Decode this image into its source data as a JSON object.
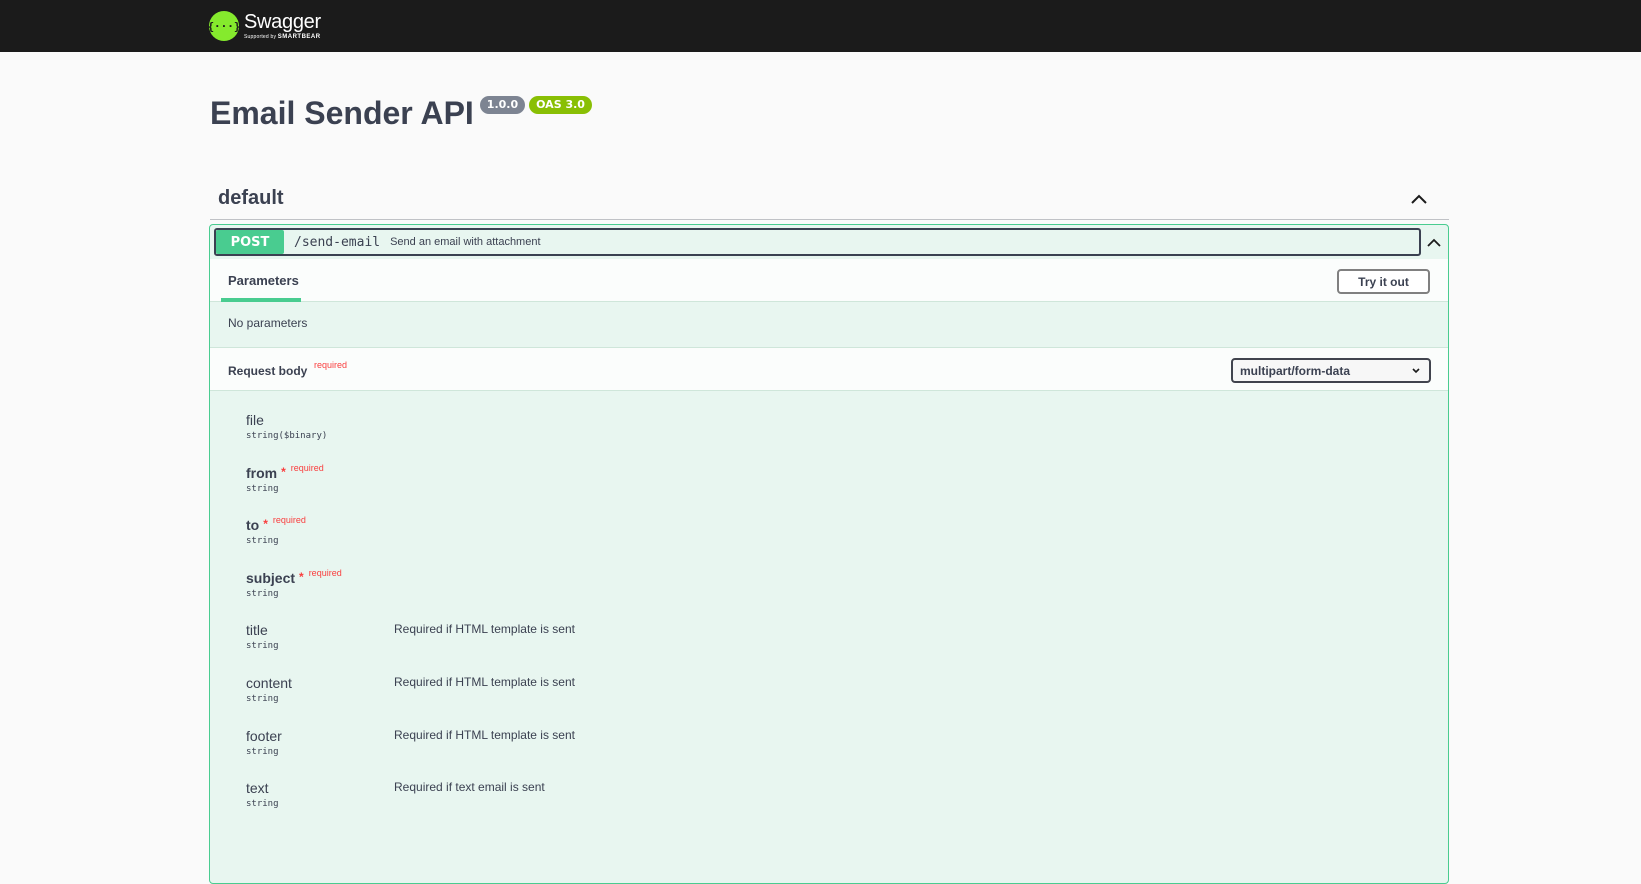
{
  "topbar": {
    "logo_mark": "{···}",
    "logo_name": "Swagger",
    "logo_sub_prefix": "Supported by ",
    "logo_sub_brand": "SMARTBEAR"
  },
  "info": {
    "title": "Email Sender API",
    "version": "1.0.0",
    "oas": "OAS 3.0"
  },
  "tag": {
    "name": "default",
    "icon": "chevron-up-icon"
  },
  "operation": {
    "method": "POST",
    "path": "/send-email",
    "summary": "Send an email with attachment",
    "colors": {
      "method": "#49cc90",
      "background": "#e8f6f0"
    }
  },
  "parameters": {
    "tab_label": "Parameters",
    "try_label": "Try it out",
    "empty_text": "No parameters"
  },
  "request_body": {
    "title": "Request body",
    "required_label": "required",
    "content_type": "multipart/form-data",
    "properties": [
      {
        "name": "file",
        "type": "string($binary)",
        "required": false,
        "description": ""
      },
      {
        "name": "from",
        "type": "string",
        "required": true,
        "description": ""
      },
      {
        "name": "to",
        "type": "string",
        "required": true,
        "description": ""
      },
      {
        "name": "subject",
        "type": "string",
        "required": true,
        "description": ""
      },
      {
        "name": "title",
        "type": "string",
        "required": false,
        "description": "Required if HTML template is sent"
      },
      {
        "name": "content",
        "type": "string",
        "required": false,
        "description": "Required if HTML template is sent"
      },
      {
        "name": "footer",
        "type": "string",
        "required": false,
        "description": "Required if HTML template is sent"
      },
      {
        "name": "text",
        "type": "string",
        "required": false,
        "description": "Required if text email is sent"
      }
    ],
    "star": "*",
    "prop_required_label": "required"
  }
}
